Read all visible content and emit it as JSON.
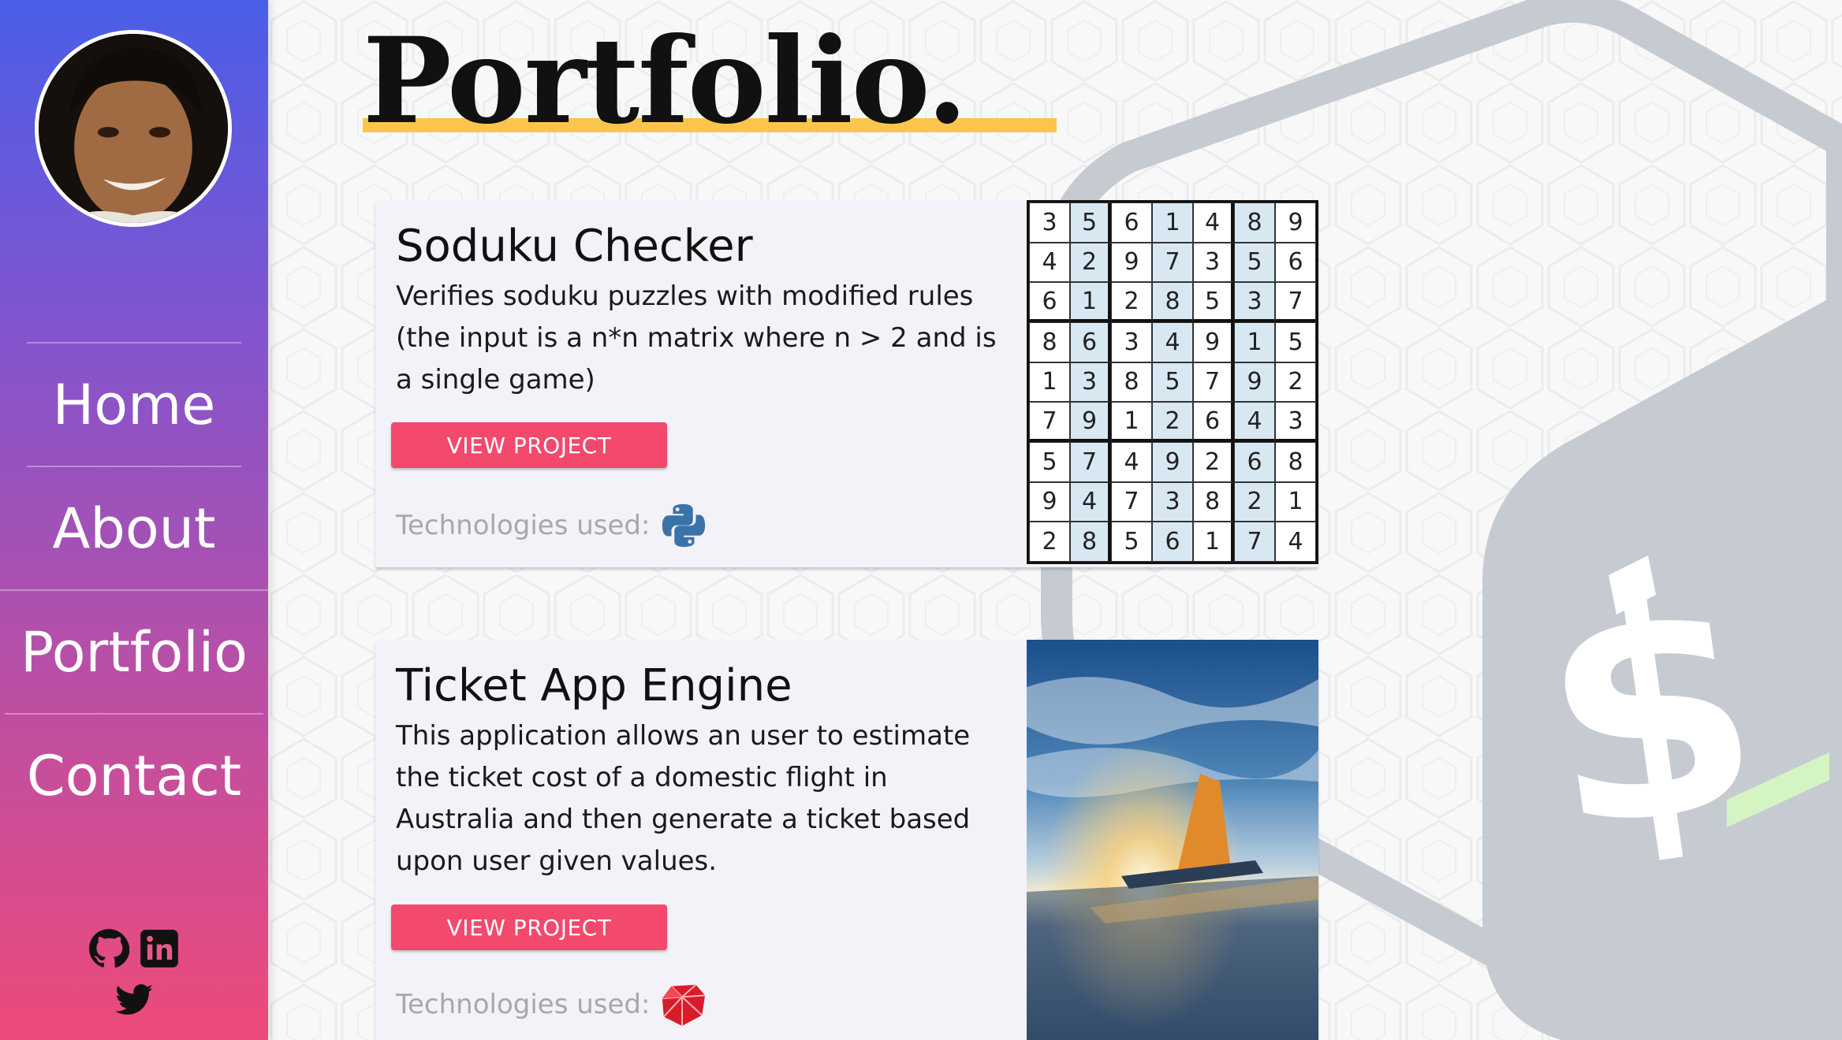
{
  "nav": {
    "items": [
      {
        "label": "Home"
      },
      {
        "label": "About"
      },
      {
        "label": "Portfolio"
      },
      {
        "label": "Contact"
      }
    ]
  },
  "social": {
    "icons": [
      "github-icon",
      "linkedin-icon",
      "twitter-icon"
    ]
  },
  "main": {
    "title": "Portfolio."
  },
  "projects": [
    {
      "title": "Soduku Checker",
      "description": "Verifies soduku puzzles with modified rules (the input is a n*n matrix where n > 2 and is a single game)",
      "button_label": "View Project",
      "tech_label": "Technologies used:",
      "tech_icon": "python-icon",
      "image": "sudoku-grid",
      "grid": [
        [
          "3",
          "5",
          "6",
          "1",
          "4",
          "8",
          "9"
        ],
        [
          "4",
          "2",
          "9",
          "7",
          "3",
          "5",
          "6"
        ],
        [
          "6",
          "1",
          "2",
          "8",
          "5",
          "3",
          "7"
        ],
        [
          "8",
          "6",
          "3",
          "4",
          "9",
          "1",
          "5"
        ],
        [
          "1",
          "3",
          "8",
          "5",
          "7",
          "9",
          "2"
        ],
        [
          "7",
          "9",
          "1",
          "2",
          "6",
          "4",
          "3"
        ],
        [
          "5",
          "7",
          "4",
          "9",
          "2",
          "6",
          "8"
        ],
        [
          "9",
          "4",
          "7",
          "3",
          "8",
          "2",
          "1"
        ],
        [
          "2",
          "8",
          "5",
          "6",
          "1",
          "7",
          "4"
        ]
      ]
    },
    {
      "title": "Ticket App Engine",
      "description": "This application allows an user to estimate the ticket cost of a domestic flight in Australia and then generate a ticket based upon user given values.",
      "button_label": "View Project",
      "tech_label": "Technologies used:",
      "tech_icon": "ruby-icon",
      "image": "airplane-wing-photo"
    }
  ],
  "colors": {
    "accent_button": "#f2496c",
    "title_underline": "#fbc54d",
    "sidebar_top": "#4a5ee8",
    "sidebar_bottom": "#ee4a7a"
  }
}
